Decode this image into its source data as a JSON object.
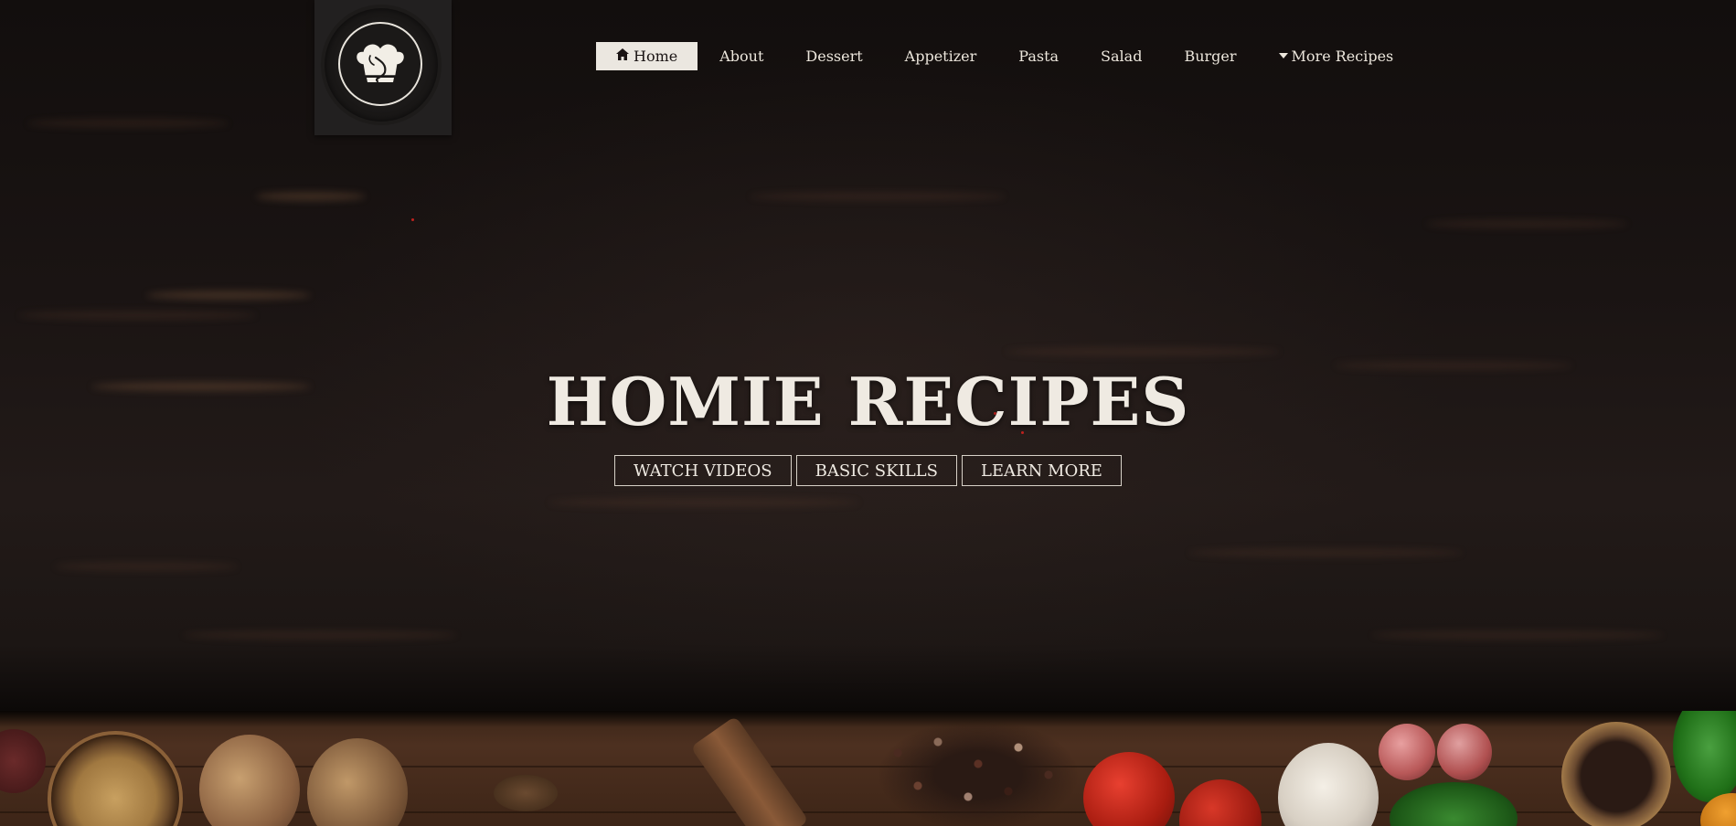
{
  "brand": {
    "logo_icon": "chef-hat-icon"
  },
  "nav": {
    "items": [
      {
        "label": "Home",
        "icon": "home-icon",
        "active": true
      },
      {
        "label": "About",
        "active": false
      },
      {
        "label": "Dessert",
        "active": false
      },
      {
        "label": "Appetizer",
        "active": false
      },
      {
        "label": "Pasta",
        "active": false
      },
      {
        "label": "Salad",
        "active": false
      },
      {
        "label": "Burger",
        "active": false
      },
      {
        "label": "More Recipes",
        "icon": "caret-down-icon",
        "active": false
      }
    ]
  },
  "hero": {
    "title": "HOMIE RECIPES",
    "buttons": [
      {
        "label": "WATCH VIDEOS"
      },
      {
        "label": "BASIC SKILLS"
      },
      {
        "label": "LEARN MORE"
      }
    ]
  },
  "colors": {
    "background": "#141010",
    "text": "#efeae2",
    "nav_active_bg": "#ebe7e0",
    "logo_box": "#222020",
    "wood": "#4d3020"
  }
}
